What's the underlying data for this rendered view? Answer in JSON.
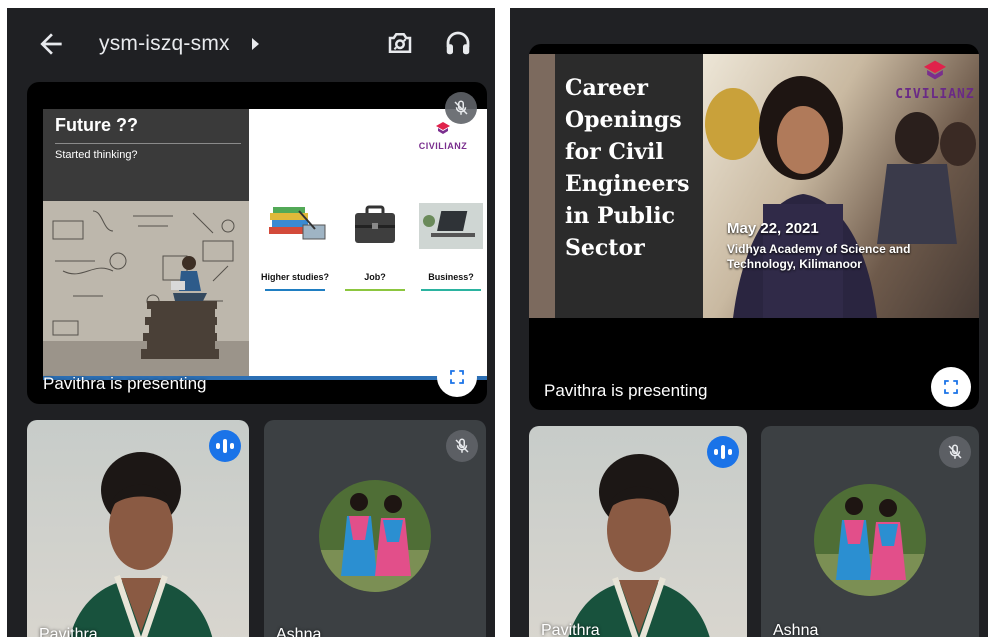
{
  "meeting": {
    "code": "ysm-iszq-smx",
    "presenter_status": "Pavithra is presenting"
  },
  "slide_left": {
    "title": "Future ??",
    "subtitle": "Started thinking?",
    "logo": "CIVILIANZ",
    "options": [
      {
        "label": "Higher studies?"
      },
      {
        "label": "Job?"
      },
      {
        "label": "Business?"
      }
    ]
  },
  "slide_right": {
    "title_lines": [
      "Career",
      "Openings",
      "for Civil",
      "Engineers",
      "in  Public",
      "Sector"
    ],
    "logo": "CIVILIANZ",
    "date": "May 22, 2021",
    "venue_line1": "Vidhya Academy of Science and",
    "venue_line2": "Technology, Kilimanoor"
  },
  "participants": [
    {
      "name": "Pavithra",
      "status": "speaking"
    },
    {
      "name": "Ashna",
      "status": "muted"
    }
  ],
  "icons": {
    "back": "arrow-left-icon",
    "chevron": "chevron-right-icon",
    "camera_switch": "camera-switch-icon",
    "audio": "headset-icon",
    "mic_off": "mic-off-icon",
    "fullscreen": "fullscreen-icon",
    "speaking": "audio-level-icon"
  },
  "colors": {
    "background": "#202124",
    "accent_blue": "#1a73e8",
    "logo_purple": "#7a2e8e"
  }
}
